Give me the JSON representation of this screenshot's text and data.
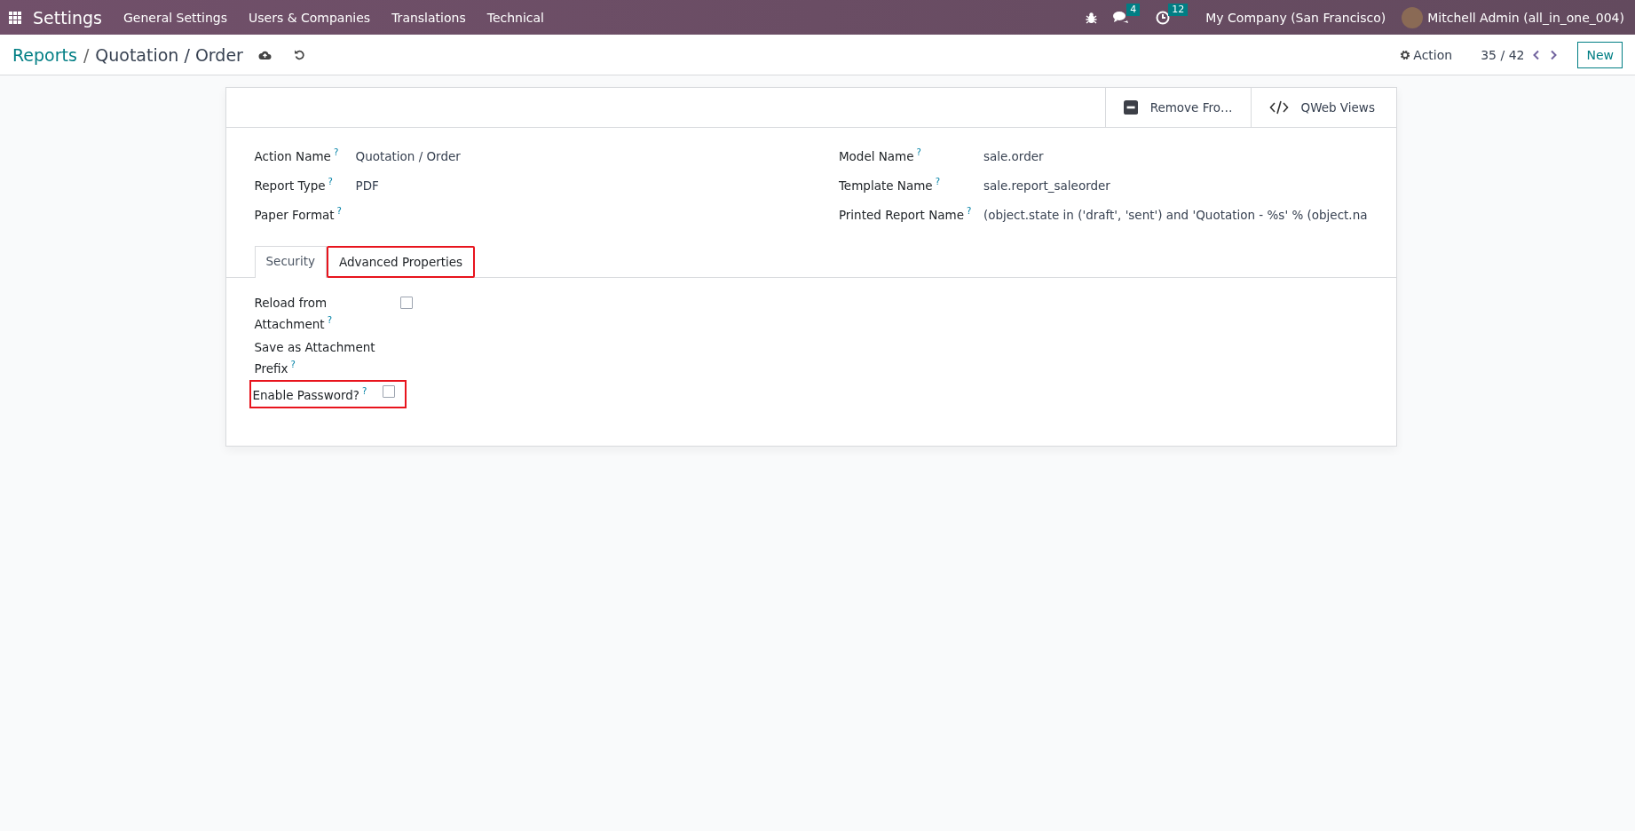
{
  "navbar": {
    "app": "Settings",
    "menu": [
      "General Settings",
      "Users & Companies",
      "Translations",
      "Technical"
    ],
    "messages_badge": "4",
    "activities_badge": "12",
    "company": "My Company (San Francisco)",
    "user": "Mitchell Admin (all_in_one_004)"
  },
  "breadcrumb": {
    "parent": "Reports",
    "separator": "/",
    "current": "Quotation / Order"
  },
  "control_panel": {
    "action": "Action",
    "pager": "35 / 42",
    "new_button": "New"
  },
  "button_box": [
    {
      "label": "Remove Fro…",
      "kind": "remove"
    },
    {
      "label": "QWeb Views",
      "kind": "code"
    }
  ],
  "fields_left": [
    {
      "label": "Action Name",
      "help": "?",
      "value": "Quotation / Order"
    },
    {
      "label": "Report Type",
      "help": "?",
      "value": "PDF"
    },
    {
      "label": "Paper Format",
      "help": "?"
    }
  ],
  "fields_right": [
    {
      "label": "Model Name",
      "help": "?",
      "value": "sale.order"
    },
    {
      "label": "Template Name",
      "help": "?",
      "value": "sale.report_saleorder"
    },
    {
      "label": "Printed Report Name",
      "help": "?",
      "value": "(object.state in ('draft', 'sent') and 'Quotation - %s' % (object.na"
    }
  ],
  "tabs": [
    {
      "label": "Security",
      "selected": false,
      "highlighted": false
    },
    {
      "label": "Advanced Properties",
      "selected": true,
      "highlighted": true
    }
  ],
  "advanced": [
    {
      "label": "Reload from Attachment",
      "help": "?",
      "kind": "checkbox",
      "checked": false
    },
    {
      "label": "Save as Attachment Prefix",
      "help": "?",
      "kind": "text"
    },
    {
      "label": "Enable Password?",
      "help": "?",
      "kind": "checkbox",
      "checked": false,
      "highlighted": true
    }
  ]
}
